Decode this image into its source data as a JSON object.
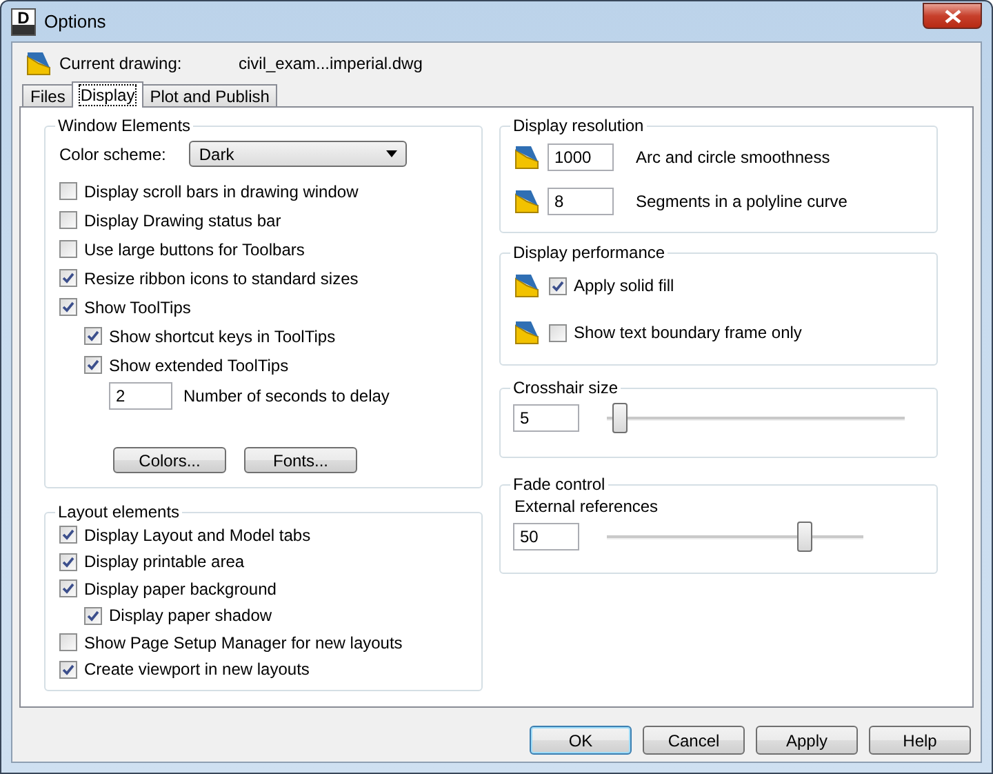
{
  "window": {
    "title": "Options",
    "icon_letter": "D"
  },
  "current_drawing": {
    "label": "Current drawing:",
    "value": "civil_exam...imperial.dwg"
  },
  "tabs": [
    {
      "label": "Files",
      "selected": false
    },
    {
      "label": "Display",
      "selected": true
    },
    {
      "label": "Plot and Publish",
      "selected": false
    }
  ],
  "window_elements": {
    "title": "Window Elements",
    "color_scheme": {
      "label": "Color scheme:",
      "value": "Dark"
    },
    "items": [
      {
        "label": "Display scroll bars in drawing window",
        "checked": false
      },
      {
        "label": "Display Drawing status bar",
        "checked": false
      },
      {
        "label": "Use large buttons for Toolbars",
        "checked": false
      },
      {
        "label": "Resize ribbon icons to standard sizes",
        "checked": true
      },
      {
        "label": "Show ToolTips",
        "checked": true,
        "children": [
          {
            "label": "Show shortcut keys in ToolTips",
            "checked": true
          },
          {
            "label": "Show extended ToolTips",
            "checked": true
          }
        ]
      }
    ],
    "delay": {
      "value": "2",
      "label": "Number of seconds to delay"
    },
    "buttons": [
      "Colors...",
      "Fonts..."
    ]
  },
  "layout_elements": {
    "title": "Layout elements",
    "items": [
      {
        "label": "Display Layout and Model tabs",
        "checked": true
      },
      {
        "label": "Display printable area",
        "checked": true
      },
      {
        "label": "Display paper background",
        "checked": true,
        "children": [
          {
            "label": "Display paper shadow",
            "checked": true
          }
        ]
      },
      {
        "label": "Show Page Setup Manager for new layouts",
        "checked": false
      },
      {
        "label": "Create viewport in new layouts",
        "checked": true
      }
    ]
  },
  "display_resolution": {
    "title": "Display resolution",
    "rows": [
      {
        "value": "1000",
        "label": "Arc and circle smoothness"
      },
      {
        "value": "8",
        "label": "Segments in a polyline curve"
      }
    ]
  },
  "display_performance": {
    "title": "Display performance",
    "items": [
      {
        "label": "Apply solid fill",
        "checked": true
      },
      {
        "label": "Show text boundary frame only",
        "checked": false
      }
    ]
  },
  "crosshair_size": {
    "title": "Crosshair size",
    "value": "5",
    "level": 0.04
  },
  "fade_control": {
    "title": "Fade control",
    "label": "External references",
    "value": "50",
    "level": 0.77
  },
  "dialog_buttons": [
    {
      "label": "OK",
      "default": true
    },
    {
      "label": "Cancel",
      "default": false
    },
    {
      "label": "Apply",
      "default": false
    },
    {
      "label": "Help",
      "default": false
    }
  ]
}
